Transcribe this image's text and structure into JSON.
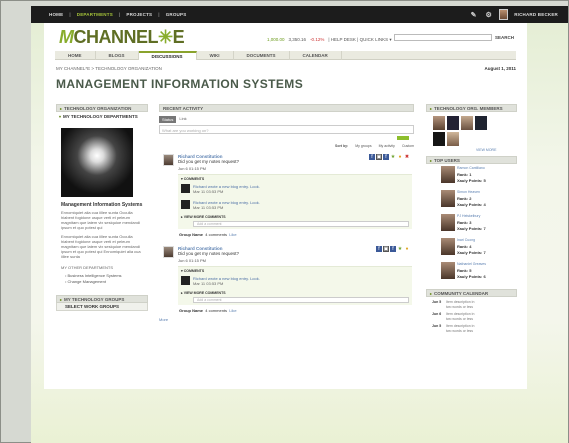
{
  "topbar": {
    "nav": [
      "HOME",
      "DEPARTMENTS",
      "PROJECTS",
      "GROUPS"
    ],
    "active_index": 1,
    "separator": "|",
    "user_name": "RICHARD BECKER"
  },
  "header": {
    "logo_prefix": "CHANNEL",
    "logo_mark": "✳",
    "logo_suffix": "E",
    "stock_ticker": "1,000.00",
    "stock_value": "3,350.16",
    "stock_change": "-0.12%",
    "links": "| HELP DESK | QUICK LINKS ▾",
    "search_placeholder": "",
    "search_label": "SEARCH"
  },
  "tabs": [
    "HOME",
    "BLOGS",
    "DISCUSSIONS",
    "WIKI",
    "DOCUMENTS",
    "CALENDAR"
  ],
  "active_tab": 2,
  "breadcrumb": "MY CHANNEL*E  >  TECHNOLOGY ORGANIZATION",
  "date": "August 1, 2011",
  "page_title": "MANAGEMENT INFORMATION SYSTEMS",
  "left": {
    "section1": "TECHNOLOGY ORGANIZATION",
    "section2": "MY TECHNOLOGY DEPARTMENTS",
    "profile_title": "Management Information Systems",
    "profile_text1": "Ennomiquiet alia cua iillee sunta Occulla hiabent fogidone usque verti et peleum magnitam que latem vix sesiquioe mendandi ipsum et quo potest qui",
    "profile_text2": "Ennomiquiet alia cua iillee sunta Occulla hiabent fogidone usque verti et peleum magnitam que latem vix sesiquioe mendandi ipsum et quo potest qui Ennomiquiet alia cua iillee sunta",
    "other_departments_label": "MY OTHER DEPARTMENTS",
    "other_departments": [
      "Business Intelligence Systems",
      "Change Management"
    ],
    "groups_label": "MY TECHNOLOGY GROUPS",
    "select_groups": "SELECT WORK GROUPS"
  },
  "middle": {
    "heading": "RECENT ACTIVITY",
    "share_tabs": [
      "Status",
      "Link"
    ],
    "share_placeholder": "What are you working on?",
    "filter": [
      "Sort by:",
      "My groups",
      "My activity",
      "Custom"
    ],
    "posts": [
      {
        "author": "Richard Constitution",
        "question": "Did you get my notes request?",
        "time": "Jun 6 01:15 PM",
        "comments_label": "COMMENTS",
        "comments": [
          {
            "text": "Richard wrote a new blog entry. Look.",
            "time": "Mar 11 03:53 PM"
          },
          {
            "text": "Richard wrote a new blog entry. Look.",
            "time": "Mar 11 03:53 PM"
          }
        ],
        "view_more": "VIEW MORE COMMENTS",
        "add_placeholder": "Add a comment",
        "group_label": "Group Name",
        "comment_count": "4 comments",
        "reply": "Like"
      },
      {
        "author": "Richard Constitution",
        "question": "Did you get my notes request?",
        "time": "Jun 6 01:15 PM",
        "comments_label": "COMMENTS",
        "comments": [
          {
            "text": "Richard wrote a new blog entry. Look.",
            "time": "Mar 11 03:53 PM"
          }
        ],
        "view_more": "VIEW MORE COMMENTS",
        "add_placeholder": "Add a comment",
        "group_label": "Group Name",
        "comment_count": "4 comments",
        "reply": "Like"
      }
    ],
    "more": "More"
  },
  "right": {
    "members_heading": "TECHNOLOGY ORG. MEMBERS",
    "view_more": "VIEW MORE",
    "users_heading": "TOP USERS",
    "users": [
      {
        "name": "Ramon Cantiliano",
        "rank": "Rank: 1",
        "points": "Xauly Points: 5"
      },
      {
        "name": "Simon Heaven",
        "rank": "Rank: 2",
        "points": "Xauly Points: 4"
      },
      {
        "name": "PJ Helskelbury",
        "rank": "Rank: 3",
        "points": "Xauly Points: 7"
      },
      {
        "name": "Inari Cuong",
        "rank": "Rank: 4",
        "points": "Xauly Points: 7"
      },
      {
        "name": "Nathaniel Greaves",
        "rank": "Rank: 5",
        "points": "Xauly Points: 6"
      }
    ],
    "calendar_heading": "COMMUNITY CALENDAR",
    "events": [
      {
        "date": "Jun 5",
        "text": "Item description in two words or less"
      },
      {
        "date": "Jun 6",
        "text": "Item description in two words or less"
      },
      {
        "date": "Jun 5",
        "text": "Item description in two words or less"
      }
    ]
  },
  "colors": {
    "accent": "#8aa32d",
    "topbar": "#1c1c1c",
    "link": "#5a7fb0"
  }
}
